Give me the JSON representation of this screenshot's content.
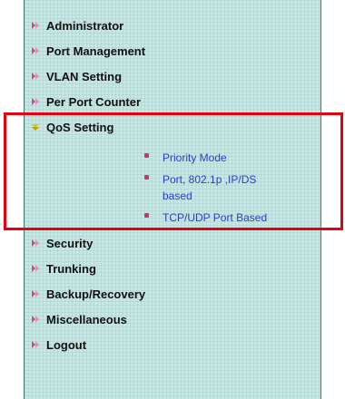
{
  "menu": {
    "items": [
      {
        "label": "Administrator",
        "icon": "arrow-right-icon"
      },
      {
        "label": "Port Management",
        "icon": "arrow-right-icon"
      },
      {
        "label": "VLAN Setting",
        "icon": "arrow-right-icon"
      },
      {
        "label": "Per Port Counter",
        "icon": "arrow-right-icon"
      },
      {
        "label": "QoS Setting",
        "icon": "arrow-down-icon",
        "expanded": true
      },
      {
        "label": "Security",
        "icon": "arrow-right-icon"
      },
      {
        "label": "Trunking",
        "icon": "arrow-right-icon"
      },
      {
        "label": "Backup/Recovery",
        "icon": "arrow-right-icon"
      },
      {
        "label": "Miscellaneous",
        "icon": "arrow-right-icon"
      },
      {
        "label": "Logout",
        "icon": "arrow-right-icon"
      }
    ],
    "qos_submenu": [
      {
        "label": "Priority Mode"
      },
      {
        "label": "Port, 802.1p ,IP/DS based"
      },
      {
        "label": "TCP/UDP Port Based"
      }
    ]
  },
  "colors": {
    "panel_background": "#c8e6e4",
    "menu_text": "#111111",
    "submenu_text": "#2b3fc8",
    "bullet": "#d0306f",
    "arrow_right": "#d9457a",
    "arrow_down": "#e0c800",
    "highlight_border": "#e3000f"
  }
}
